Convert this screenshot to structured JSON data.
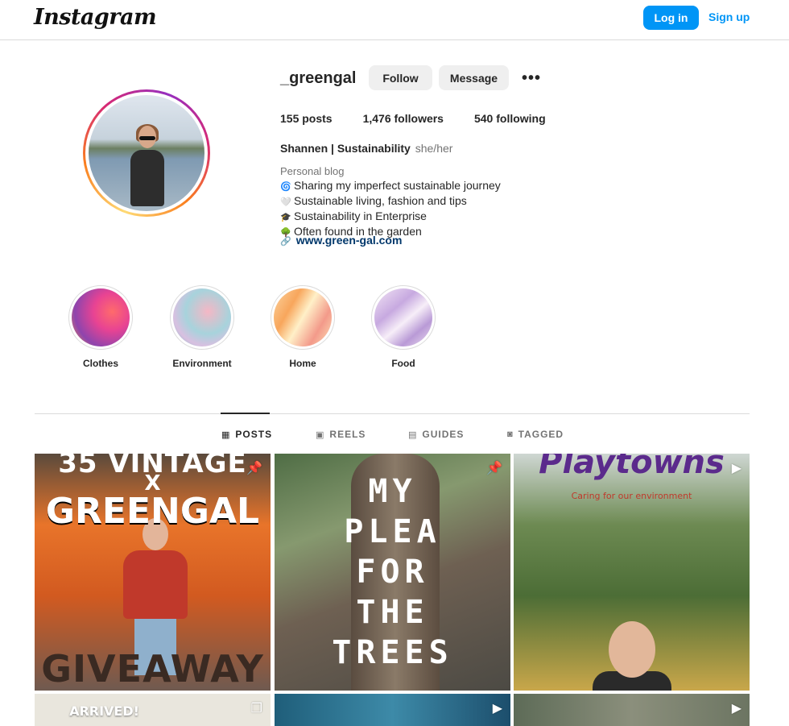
{
  "header": {
    "logo": "Instagram",
    "login_label": "Log in",
    "signup_label": "Sign up"
  },
  "profile": {
    "username": "_greengal",
    "follow_label": "Follow",
    "message_label": "Message",
    "more_label": "•••",
    "stats": {
      "posts": "155 posts",
      "followers": "1,476 followers",
      "following": "540 following"
    },
    "full_name": "Shannen | Sustainability",
    "pronouns": "she/her",
    "category": "Personal blog",
    "bio": [
      {
        "emoji": "🌀",
        "text": "Sharing my imperfect sustainable journey"
      },
      {
        "emoji": "🤍",
        "text": "Sustainable living, fashion and tips"
      },
      {
        "emoji": "🎓",
        "text": "Sustainability in Enterprise"
      },
      {
        "emoji": "🌳",
        "text": "Often found in the garden"
      }
    ],
    "link": "www.green-gal.com",
    "link_icon": "🔗"
  },
  "highlights": [
    {
      "label": "Clothes"
    },
    {
      "label": "Environment"
    },
    {
      "label": "Home"
    },
    {
      "label": "Food"
    }
  ],
  "tabs": [
    {
      "label": "POSTS",
      "icon": "▦",
      "active": true
    },
    {
      "label": "REELS",
      "icon": "▣",
      "active": false
    },
    {
      "label": "GUIDES",
      "icon": "▤",
      "active": false
    },
    {
      "label": "TAGGED",
      "icon": "◙",
      "active": false
    }
  ],
  "posts": {
    "p1_top": "35 VINTAGE",
    "p1_x": "X",
    "p1_mid": "GREENGAL",
    "p1_bottom": "GIVEAWAY",
    "p2_lines": [
      "MY",
      "PLEA",
      "FOR",
      "THE",
      "TREES"
    ],
    "p3_title": "Playtowns",
    "p3_subtitle": "Caring for our environment",
    "p4_text": "ARRIVED!",
    "pin_icon": "📌",
    "carousel_icon": "❐",
    "reel_icon": "▶"
  }
}
